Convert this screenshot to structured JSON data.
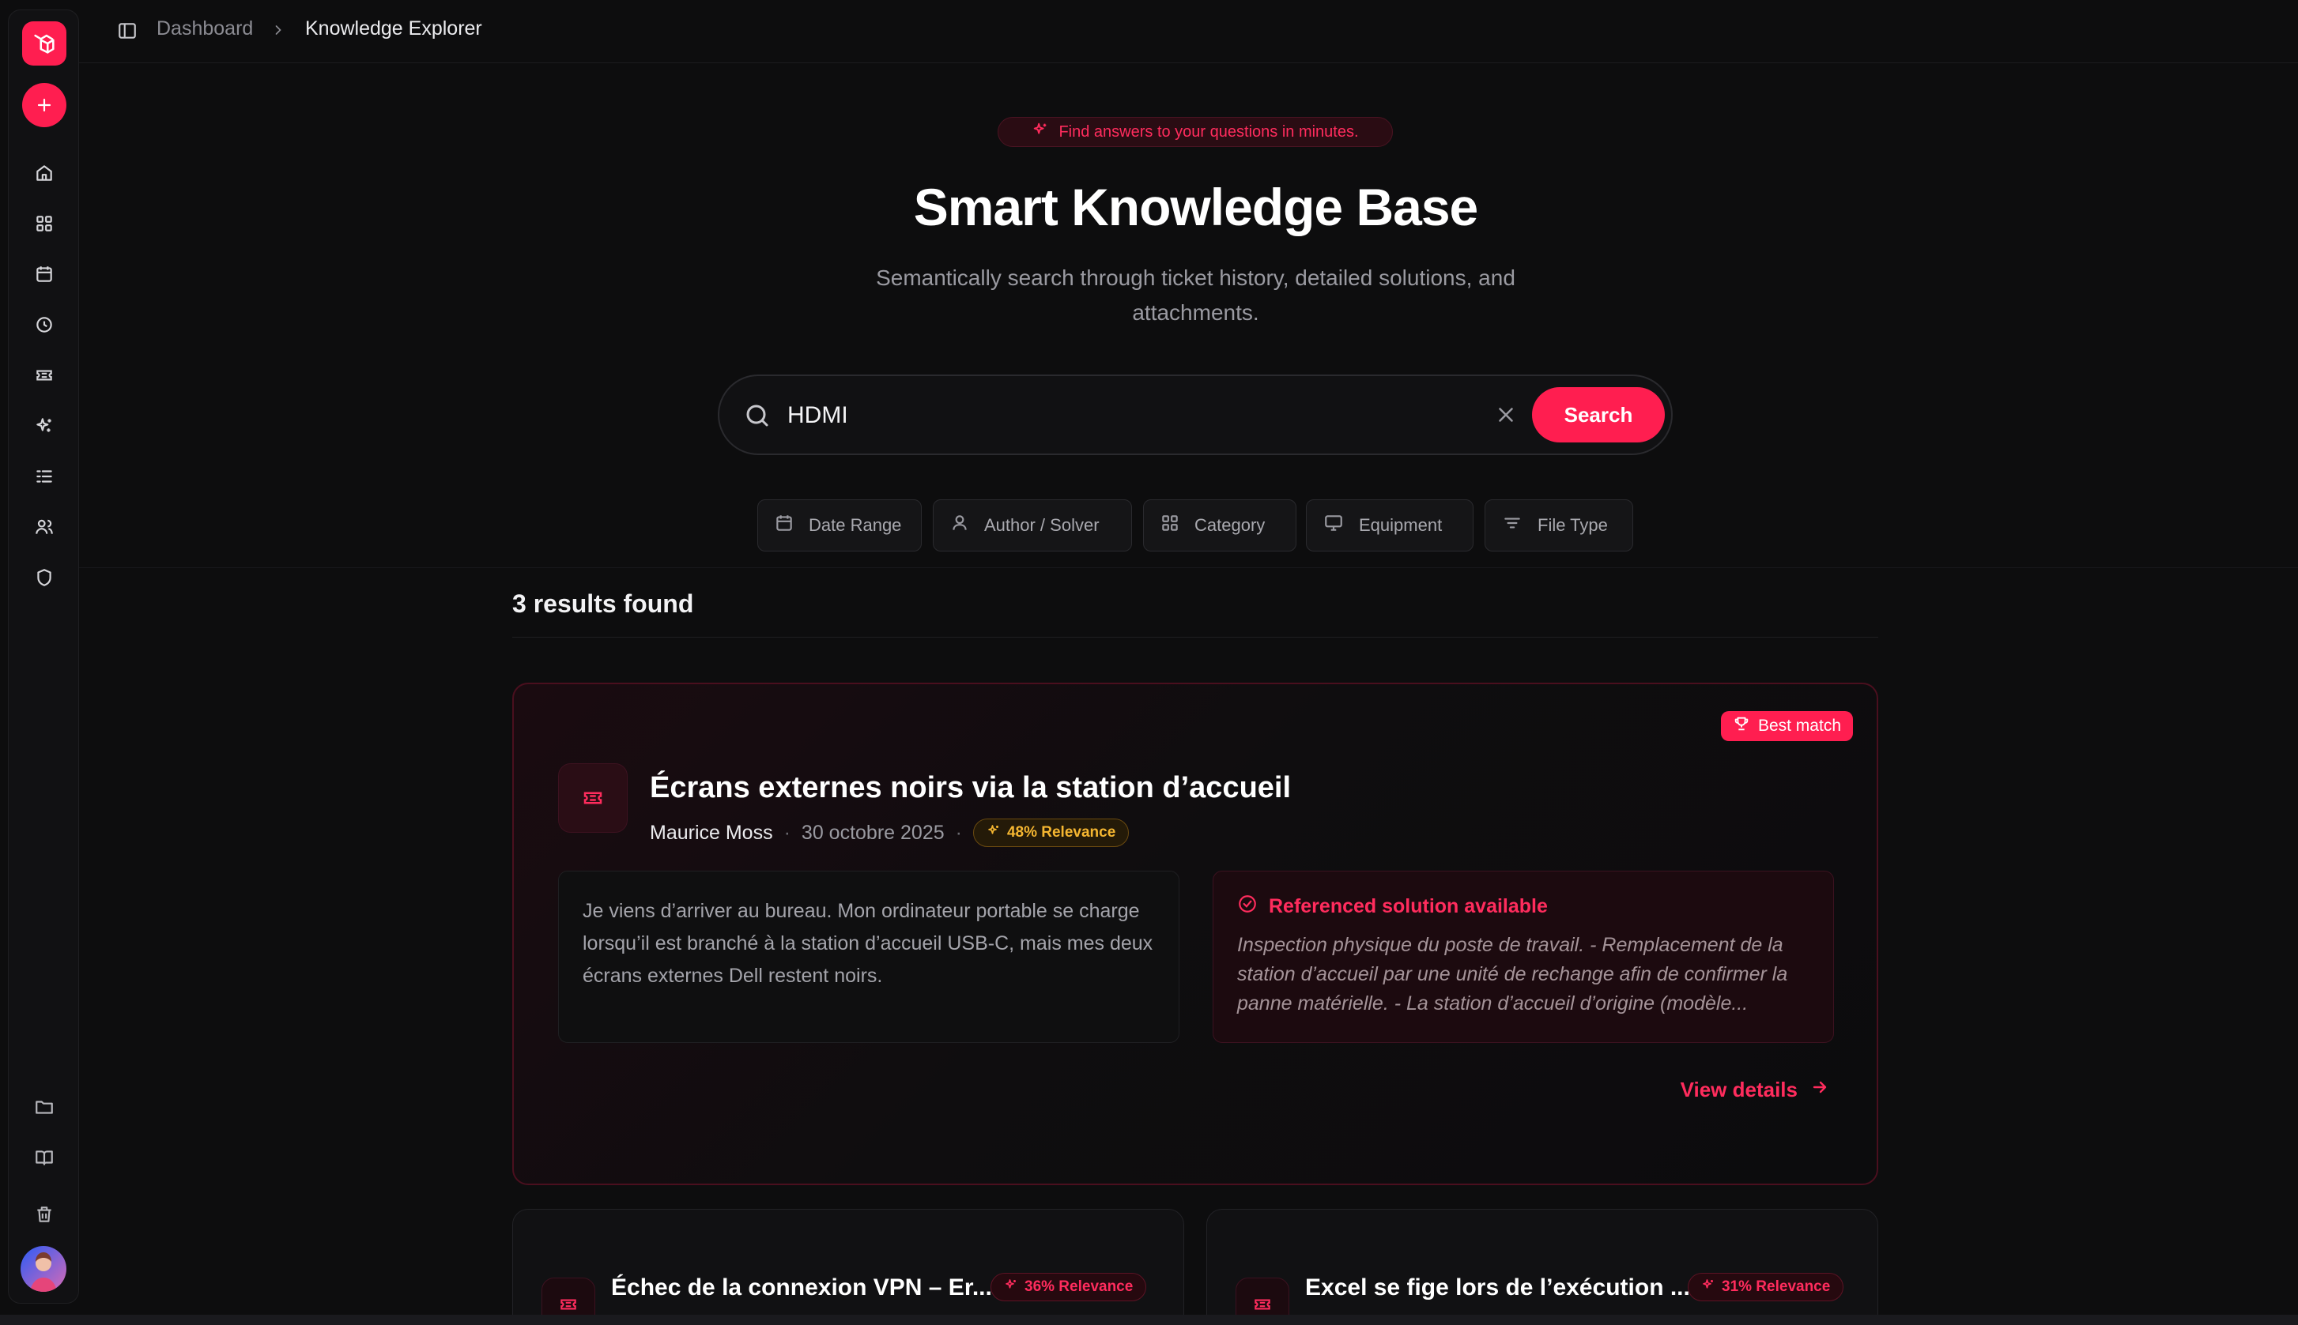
{
  "sidebar": {
    "icons": [
      "logo-icon",
      "plus-icon",
      "home-icon",
      "grid-icon",
      "calendar-icon",
      "clock-icon",
      "ticket-icon",
      "sparkles-icon",
      "list-icon",
      "users-icon",
      "shield-icon",
      "folder-icon",
      "book-icon",
      "trash-icon"
    ]
  },
  "breadcrumb": {
    "items": [
      "Dashboard",
      "Knowledge Explorer"
    ]
  },
  "hero": {
    "badge": "Find answers to your questions in minutes.",
    "title": "Smart Knowledge Base",
    "subtitle": "Semantically search through ticket history, detailed solutions, and attachments."
  },
  "search": {
    "value": "HDMI",
    "button": "Search"
  },
  "filters": [
    "Date Range",
    "Author / Solver",
    "Category",
    "Equipment",
    "File Type"
  ],
  "results": {
    "count_label": "3 results found"
  },
  "cards": [
    {
      "badge": "Best match",
      "title": "Écrans externes noirs via la station d’accueil",
      "author": "Maurice Moss",
      "date": "30 octobre 2025",
      "relevance": "48% Relevance",
      "description": "Je viens d’arriver au bureau. Mon ordinateur portable se charge lorsqu’il est branché à la station d’accueil USB-C, mais mes deux écrans externes Dell restent noirs.",
      "solution_label": "Referenced solution available",
      "solution_text": "Inspection physique du poste de travail. - Remplacement de la station d’accueil par une unité de rechange afin de confirmer la panne matérielle. - La station d’accueil d’origine (modèle...",
      "view_details": "View details"
    },
    {
      "title": "Échec de la connexion VPN – Er...",
      "relevance": "36% Relevance"
    },
    {
      "title": "Excel se fige lors de l’exécution ...",
      "relevance": "31% Relevance"
    }
  ],
  "colors": {
    "accent": "#ff1e50",
    "background": "#0d0d0e",
    "relevance_gold": "#f5b631"
  }
}
